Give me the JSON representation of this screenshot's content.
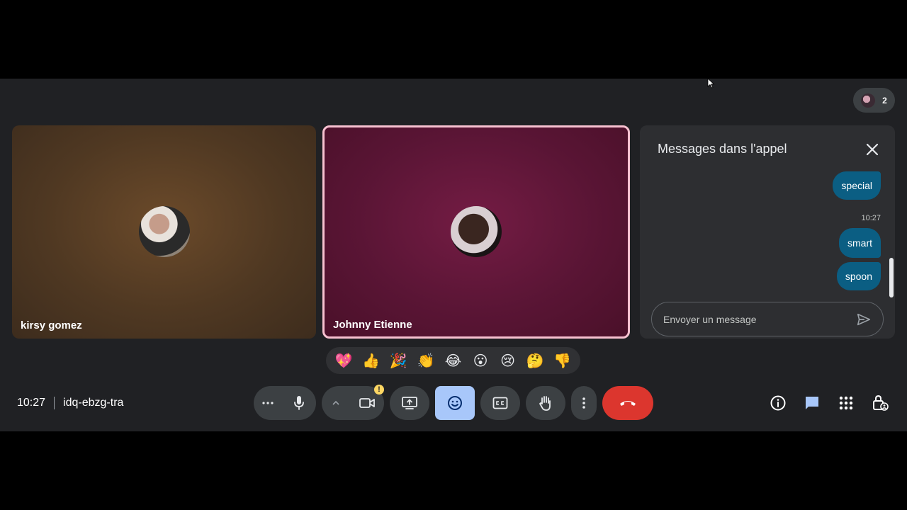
{
  "participants": {
    "count": "2"
  },
  "tiles": [
    {
      "name": "kirsy gomez"
    },
    {
      "name": "Johnny Etienne"
    }
  ],
  "chat": {
    "title": "Messages dans l'appel",
    "messages": [
      "special",
      "smart",
      "spoon"
    ],
    "time": "10:27",
    "input_placeholder": "Envoyer un message"
  },
  "reactions": [
    "💖",
    "👍",
    "🎉",
    "👏",
    "😂",
    "😮",
    "😢",
    "🤔",
    "👎"
  ],
  "meeting": {
    "time": "10:27",
    "code": "idq-ebzg-tra"
  },
  "colors": {
    "leave": "#dc362e",
    "active": "#a8c7fa",
    "bubble": "#0b5e83",
    "speaking_border": "#f7c1d0"
  }
}
